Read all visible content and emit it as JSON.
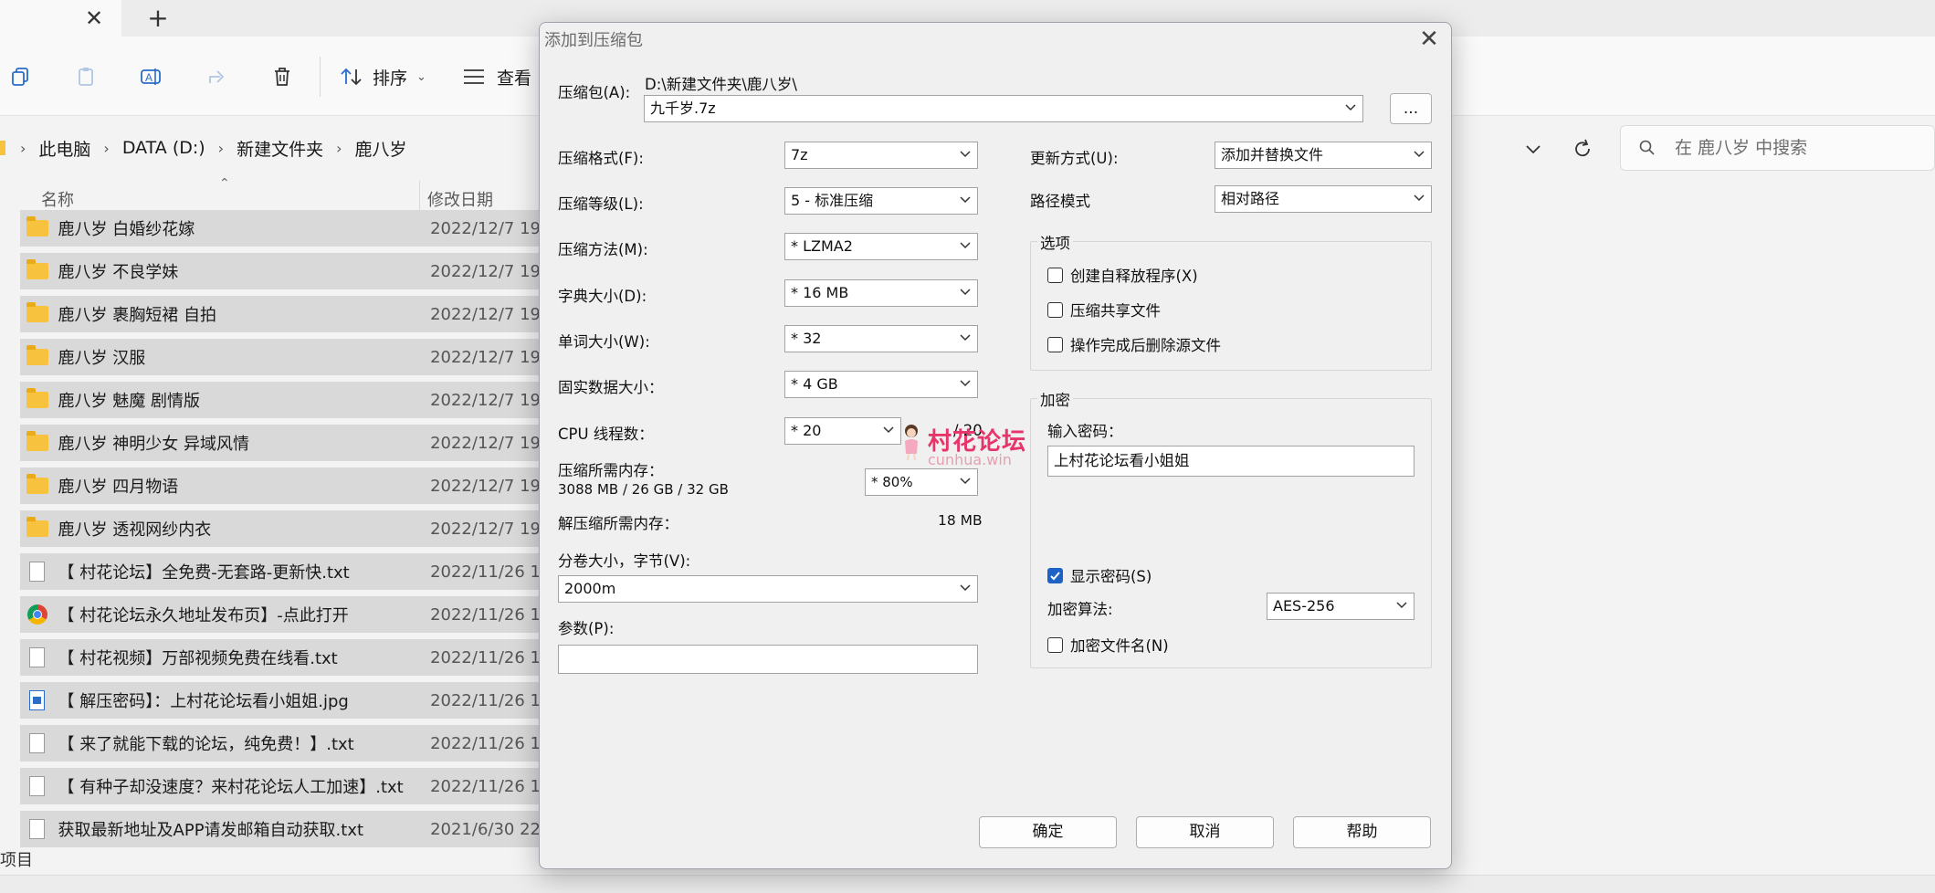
{
  "explorer": {
    "toolbar": {
      "sort_label": "排序",
      "view_label": "查看"
    },
    "breadcrumb": [
      "此电脑",
      "DATA (D:)",
      "新建文件夹",
      "鹿八岁"
    ],
    "search_placeholder": "在 鹿八岁 中搜索",
    "columns": {
      "name": "名称",
      "date": "修改日期"
    },
    "files": [
      {
        "name": "鹿八岁 白婚纱花嫁",
        "date": "2022/12/7 19",
        "icon": "folder-icon"
      },
      {
        "name": "鹿八岁 不良学妹",
        "date": "2022/12/7 19",
        "icon": "folder-icon"
      },
      {
        "name": "鹿八岁 裹胸短裙 自拍",
        "date": "2022/12/7 19",
        "icon": "folder-icon"
      },
      {
        "name": "鹿八岁 汉服",
        "date": "2022/12/7 19",
        "icon": "folder-icon"
      },
      {
        "name": "鹿八岁 魅魔 剧情版",
        "date": "2022/12/7 19",
        "icon": "folder-icon"
      },
      {
        "name": "鹿八岁 神明少女 异域风情",
        "date": "2022/12/7 19",
        "icon": "folder-icon"
      },
      {
        "name": "鹿八岁 四月物语",
        "date": "2022/12/7 19",
        "icon": "folder-icon"
      },
      {
        "name": "鹿八岁 透视网纱内衣",
        "date": "2022/12/7 19",
        "icon": "folder-icon"
      },
      {
        "name": "【 村花论坛】全免费-无套路-更新快.txt",
        "date": "2022/11/26 1",
        "icon": "text-file-icon"
      },
      {
        "name": "【 村花论坛永久地址发布页】-点此打开",
        "date": "2022/11/26 1",
        "icon": "chrome-icon"
      },
      {
        "name": "【 村花视频】万部视频免费在线看.txt",
        "date": "2022/11/26 1",
        "icon": "text-file-icon"
      },
      {
        "name": "【 解压密码】：上村花论坛看小姐姐.jpg",
        "date": "2022/11/26 1",
        "icon": "image-file-icon"
      },
      {
        "name": "【 来了就能下载的论坛，纯免费！】.txt",
        "date": "2022/11/26 1",
        "icon": "text-file-icon"
      },
      {
        "name": "【 有种子却没速度？来村花论坛人工加速】.txt",
        "date": "2022/11/26 1",
        "icon": "text-file-icon"
      },
      {
        "name": "获取最新地址及APP请发邮箱自动获取.txt",
        "date": "2021/6/30 22",
        "icon": "text-file-icon"
      }
    ],
    "status": "项目"
  },
  "dialog": {
    "title": "添加到压缩包",
    "archive_label": "压缩包(A):",
    "archive_path": "D:\\新建文件夹\\鹿八岁\\",
    "archive_name": "九千岁.7z",
    "browse_label": "...",
    "format_label": "压缩格式(F):",
    "format_value": "7z",
    "level_label": "压缩等级(L):",
    "level_value": "5 - 标准压缩",
    "method_label": "压缩方法(M):",
    "method_value": "* LZMA2",
    "dict_label": "字典大小(D):",
    "dict_value": "* 16 MB",
    "word_label": "单词大小(W):",
    "word_value": "* 32",
    "solid_label": "固实数据大小：",
    "solid_value": "* 4 GB",
    "cpu_label": "CPU 线程数：",
    "cpu_value": "* 20",
    "cpu_total": "/ 20",
    "mem_label": "压缩所需内存：",
    "mem_value": "3088 MB / 26 GB / 32 GB",
    "mem_percent": "* 80%",
    "decomp_label": "解压缩所需内存：",
    "decomp_value": "18 MB",
    "volume_label": "分卷大小，字节(V):",
    "volume_value": "2000m",
    "params_label": "参数(P):",
    "params_value": "",
    "update_label": "更新方式(U):",
    "update_value": "添加并替换文件",
    "path_label": "路径模式",
    "path_value": "相对路径",
    "options_title": "选项",
    "opt_sfx": "创建自释放程序(X)",
    "opt_shared": "压缩共享文件",
    "opt_delete": "操作完成后删除源文件",
    "encrypt_title": "加密",
    "password_label": "输入密码：",
    "password_value": "上村花论坛看小姐姐",
    "show_password": "显示密码(S)",
    "enc_method_label": "加密算法:",
    "enc_method_value": "AES-256",
    "enc_names": "加密文件名(N)",
    "ok_label": "确定",
    "cancel_label": "取消",
    "help_label": "帮助"
  },
  "watermark": {
    "text": "村花论坛",
    "sub": "cunhua.win"
  }
}
